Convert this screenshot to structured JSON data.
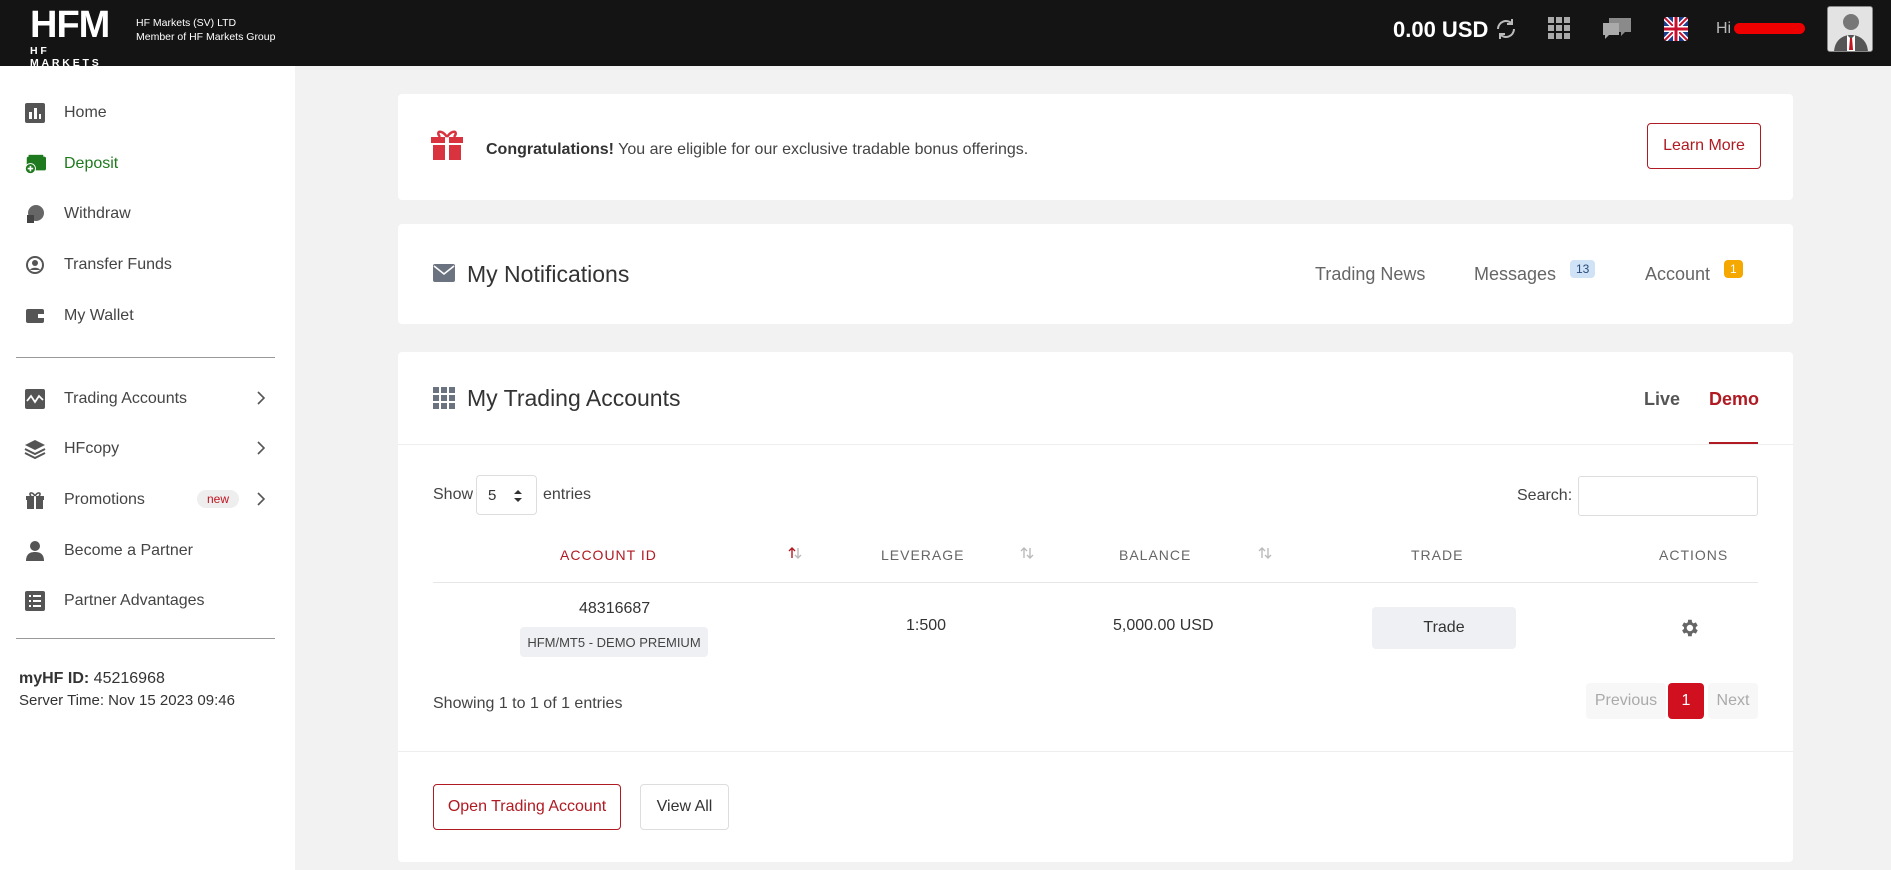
{
  "header": {
    "logo_text": "HFM",
    "logo_subtext": "HF MARKETS",
    "company_line1": "HF Markets (SV) LTD",
    "company_line2": "Member of HF Markets Group",
    "balance": "0.00 USD",
    "greeting": "Hi",
    "icons": [
      "refresh-icon",
      "apps-grid-icon",
      "chat-icon",
      "uk-flag-icon",
      "user-avatar"
    ]
  },
  "sidebar": {
    "items": [
      {
        "label": "Home",
        "icon": "chart-bar-icon"
      },
      {
        "label": "Deposit",
        "icon": "wallet-plus-icon",
        "active": true
      },
      {
        "label": "Withdraw",
        "icon": "withdraw-icon"
      },
      {
        "label": "Transfer Funds",
        "icon": "transfer-icon"
      },
      {
        "label": "My Wallet",
        "icon": "wallet-icon"
      },
      {
        "label": "Trading Accounts",
        "icon": "pulse-icon"
      },
      {
        "label": "HFcopy",
        "icon": "layers-icon"
      },
      {
        "label": "Promotions",
        "icon": "gift-icon",
        "badge": "new"
      },
      {
        "label": "Become a Partner",
        "icon": "person-icon"
      },
      {
        "label": "Partner Advantages",
        "icon": "list-icon"
      }
    ],
    "myhf_label": "myHF ID:",
    "myhf_value": " 45216968",
    "server_time": "Server Time: Nov 15 2023 09:46"
  },
  "bonus": {
    "bold": "Congratulations!",
    "text": " You are eligible for our exclusive tradable bonus offerings.",
    "button": "Learn More"
  },
  "notifications": {
    "title": "My Notifications",
    "tabs": [
      {
        "label": "Trading News"
      },
      {
        "label": "Messages",
        "count": "13"
      },
      {
        "label": "Account",
        "count": "1"
      }
    ]
  },
  "accounts": {
    "title": "My Trading Accounts",
    "tabs": {
      "live": "Live",
      "demo": "Demo"
    },
    "show_label": "Show",
    "entries_value": "5",
    "entries_label": "entries",
    "search_label": "Search:",
    "columns": [
      "ACCOUNT ID",
      "LEVERAGE",
      "BALANCE",
      "TRADE",
      "ACTIONS"
    ],
    "rows": [
      {
        "account_id": "48316687",
        "type": "HFM/MT5 - DEMO PREMIUM",
        "leverage": "1:500",
        "balance": "5,000.00 USD",
        "trade": "Trade"
      }
    ],
    "showing": "Showing 1 to 1 of 1 entries",
    "pagination": {
      "previous": "Previous",
      "page": "1",
      "next": "Next"
    },
    "open_button": "Open Trading Account",
    "view_all_button": "View All"
  },
  "colors": {
    "accent": "#b01a22",
    "active_nav": "#1f7a1f",
    "topbar": "#141414"
  }
}
